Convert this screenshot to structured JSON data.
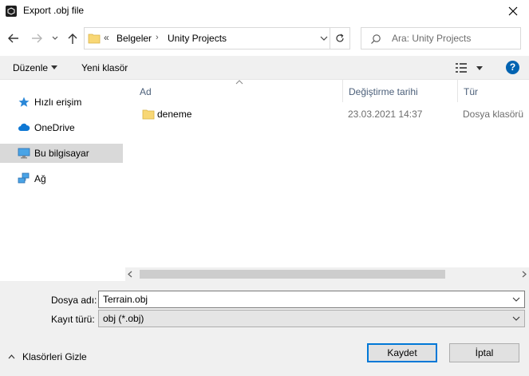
{
  "window": {
    "title": "Export .obj file",
    "close_label": "×"
  },
  "nav": {
    "back_icon": "back-arrow-icon",
    "forward_icon": "forward-arrow-icon",
    "up_icon": "up-arrow-icon"
  },
  "address": {
    "overflow": "«",
    "crumbs": [
      "Belgeler",
      "Unity Projects"
    ],
    "separator": "›"
  },
  "search": {
    "placeholder": "Ara: Unity Projects"
  },
  "toolbar": {
    "organize_label": "Düzenle",
    "new_folder_label": "Yeni klasör",
    "help_label": "?"
  },
  "sidebar": {
    "items": [
      {
        "label": "Hızlı erişim",
        "icon": "star-icon"
      },
      {
        "label": "OneDrive",
        "icon": "cloud-icon"
      },
      {
        "label": "Bu bilgisayar",
        "icon": "computer-icon",
        "selected": true
      },
      {
        "label": "Ağ",
        "icon": "network-icon"
      }
    ]
  },
  "columns": {
    "name": "Ad",
    "modified": "Değiştirme tarihi",
    "type": "Tür"
  },
  "files": [
    {
      "name": "deneme",
      "modified": "23.03.2021 14:37",
      "type": "Dosya klasörü"
    }
  ],
  "form": {
    "filename_label": "Dosya adı:",
    "filename_value": "Terrain.obj",
    "filetype_label": "Kayıt türü:",
    "filetype_value": "obj (*.obj)"
  },
  "footer": {
    "hide_folders_label": "Klasörleri Gizle",
    "save_label": "Kaydet",
    "cancel_label": "İptal"
  },
  "colors": {
    "accent": "#0078d7",
    "folder": "#f8d775",
    "selected": "#d9d9d9",
    "header_text": "#4c607a"
  }
}
